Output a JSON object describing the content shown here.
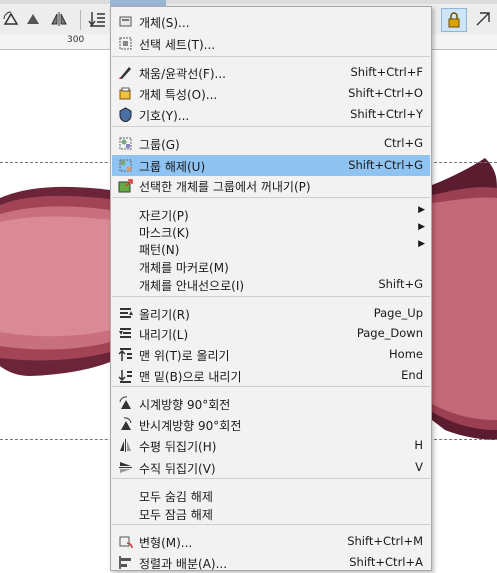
{
  "menu": {
    "items": [
      {
        "label": "개체(S)...",
        "shortcut": "",
        "icon": "object-icon",
        "submenu": false,
        "highlighted": false
      },
      {
        "label": "선택 세트(T)...",
        "shortcut": "",
        "icon": "selection-set-icon",
        "submenu": false,
        "highlighted": false
      },
      {
        "label": "채움/윤곽선(F)...",
        "shortcut": "Shift+Ctrl+F",
        "icon": "fill-stroke-icon",
        "submenu": false,
        "highlighted": false
      },
      {
        "label": "개체 특성(O)...",
        "shortcut": "Shift+Ctrl+O",
        "icon": "object-properties-icon",
        "submenu": false,
        "highlighted": false
      },
      {
        "label": "기호(Y)...",
        "shortcut": "Shift+Ctrl+Y",
        "icon": "symbols-icon",
        "submenu": false,
        "highlighted": false
      },
      {
        "label": "그룹(G)",
        "shortcut": "Ctrl+G",
        "icon": "group-icon",
        "submenu": false,
        "highlighted": false
      },
      {
        "label": "그룹 해제(U)",
        "shortcut": "Shift+Ctrl+G",
        "icon": "ungroup-icon",
        "submenu": false,
        "highlighted": true
      },
      {
        "label": "선택한 개체를 그룹에서 꺼내기(P)",
        "shortcut": "",
        "icon": "pop-from-group-icon",
        "submenu": false,
        "highlighted": false
      },
      {
        "label": "자르기(P)",
        "shortcut": "",
        "icon": "",
        "submenu": true,
        "highlighted": false
      },
      {
        "label": "마스크(K)",
        "shortcut": "",
        "icon": "",
        "submenu": true,
        "highlighted": false
      },
      {
        "label": "패턴(N)",
        "shortcut": "",
        "icon": "",
        "submenu": true,
        "highlighted": false
      },
      {
        "label": "개체를 마커로(M)",
        "shortcut": "",
        "icon": "",
        "submenu": false,
        "highlighted": false
      },
      {
        "label": "개체를 안내선으로(I)",
        "shortcut": "Shift+G",
        "icon": "",
        "submenu": false,
        "highlighted": false
      },
      {
        "label": "올리기(R)",
        "shortcut": "Page_Up",
        "icon": "raise-icon",
        "submenu": false,
        "highlighted": false
      },
      {
        "label": "내리기(L)",
        "shortcut": "Page_Down",
        "icon": "lower-icon",
        "submenu": false,
        "highlighted": false
      },
      {
        "label": "맨 위(T)로 올리기",
        "shortcut": "Home",
        "icon": "raise-to-top-icon",
        "submenu": false,
        "highlighted": false
      },
      {
        "label": "맨 밑(B)으로 내리기",
        "shortcut": "End",
        "icon": "lower-to-bottom-icon",
        "submenu": false,
        "highlighted": false
      },
      {
        "label": "시계방향 90°회전",
        "shortcut": "",
        "icon": "rotate-cw-icon",
        "submenu": false,
        "highlighted": false
      },
      {
        "label": "반시계방향 90°회전",
        "shortcut": "",
        "icon": "rotate-ccw-icon",
        "submenu": false,
        "highlighted": false
      },
      {
        "label": "수평 뒤집기(H)",
        "shortcut": "H",
        "icon": "flip-horizontal-icon",
        "submenu": false,
        "highlighted": false
      },
      {
        "label": "수직 뒤집기(V)",
        "shortcut": "V",
        "icon": "flip-vertical-icon",
        "submenu": false,
        "highlighted": false
      },
      {
        "label": "모두 숨김 해제",
        "shortcut": "",
        "icon": "",
        "submenu": false,
        "highlighted": false
      },
      {
        "label": "모두 잠금 해제",
        "shortcut": "",
        "icon": "",
        "submenu": false,
        "highlighted": false
      },
      {
        "label": "변형(M)...",
        "shortcut": "Shift+Ctrl+M",
        "icon": "transform-icon",
        "submenu": false,
        "highlighted": false
      },
      {
        "label": "정렬과 배분(A)...",
        "shortcut": "Shift+Ctrl+A",
        "icon": "align-distribute-icon",
        "submenu": false,
        "highlighted": false
      }
    ]
  },
  "ruler": {
    "label": "300"
  },
  "colors": {
    "highlight": "#8ec3f2",
    "menu_bg": "#f2f2f2",
    "art_outer": "#6b2438",
    "art_mid": "#b65a6a",
    "art_inner": "#d98a94"
  }
}
